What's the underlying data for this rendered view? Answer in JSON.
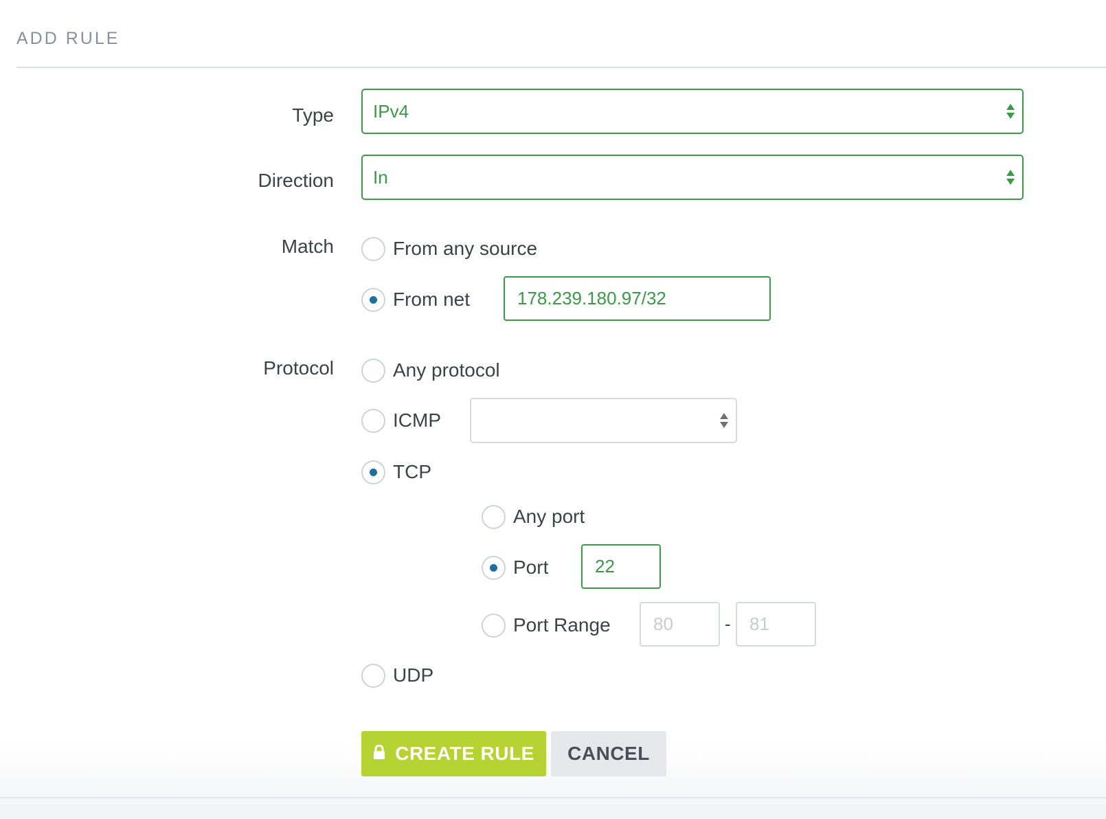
{
  "header": {
    "title": "ADD RULE"
  },
  "form": {
    "type": {
      "label": "Type",
      "value": "IPv4"
    },
    "direction": {
      "label": "Direction",
      "value": "In"
    },
    "match": {
      "label": "Match",
      "options": [
        {
          "label": "From any source",
          "selected": false
        },
        {
          "label": "From net",
          "selected": true,
          "input_value": "178.239.180.97/32"
        }
      ]
    },
    "protocol": {
      "label": "Protocol",
      "options": [
        {
          "label": "Any protocol",
          "selected": false
        },
        {
          "label": "ICMP",
          "selected": false,
          "select_value": ""
        },
        {
          "label": "TCP",
          "selected": true
        },
        {
          "label": "UDP",
          "selected": false
        }
      ],
      "tcp_ports": {
        "any_port": {
          "label": "Any port",
          "selected": false
        },
        "port": {
          "label": "Port",
          "selected": true,
          "value": "22"
        },
        "port_range": {
          "label": "Port Range",
          "selected": false,
          "from_placeholder": "80",
          "to_placeholder": "81",
          "separator": "-"
        }
      }
    }
  },
  "actions": {
    "create_label": "CREATE RULE",
    "cancel_label": "CANCEL"
  },
  "icons": {
    "lock": "lock-icon",
    "select_arrows": "select-arrows-icon",
    "radio_dot": "radio-selected-dot"
  },
  "colors": {
    "valid_green": "#3a9a47",
    "radio_blue": "#1d6f9e",
    "create_button": "#b6d333",
    "cancel_button": "#e6e8eb",
    "header_text": "#8a9099"
  }
}
